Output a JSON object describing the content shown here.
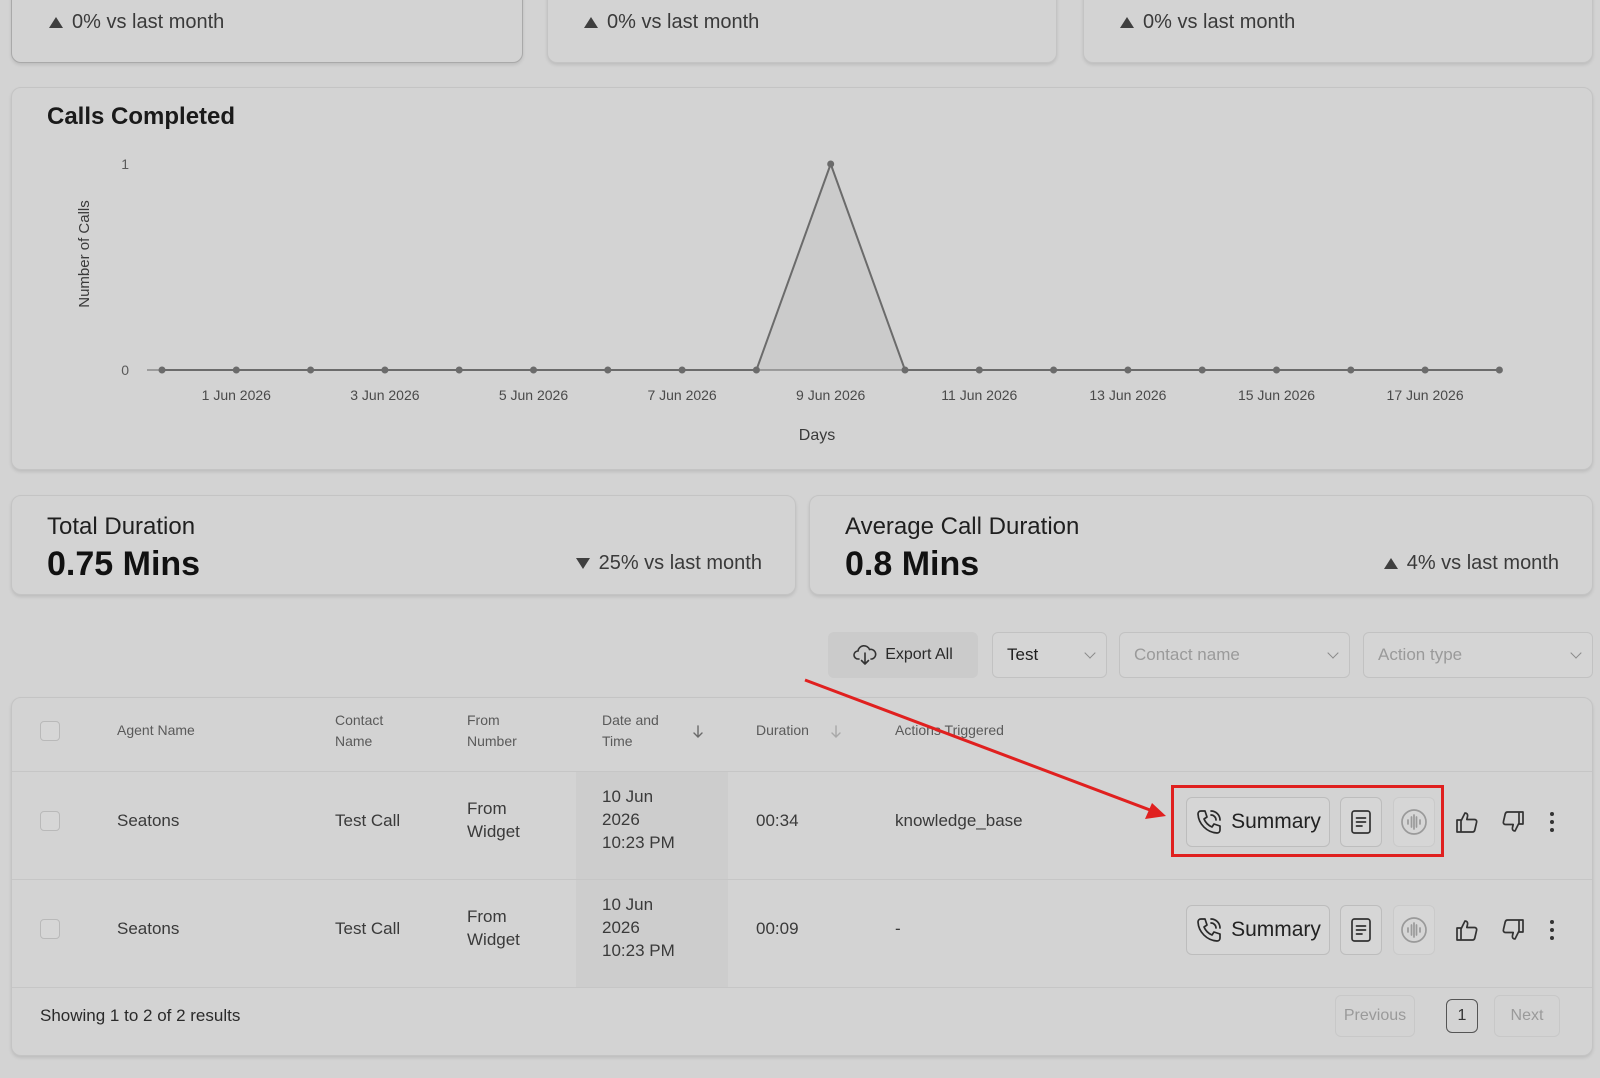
{
  "top_cards": [
    {
      "delta": "0% vs last month",
      "direction": "up"
    },
    {
      "delta": "0% vs last month",
      "direction": "up"
    },
    {
      "delta": "0% vs last month",
      "direction": "up"
    }
  ],
  "chart": {
    "title": "Calls Completed"
  },
  "chart_data": {
    "type": "line",
    "title": "Calls Completed",
    "xlabel": "Days",
    "ylabel": "Number of Calls",
    "ylim": [
      0,
      1
    ],
    "y_ticks": [
      "0",
      "1"
    ],
    "x_tick_labels": [
      "1 Jun 2026",
      "3 Jun 2026",
      "5 Jun 2026",
      "7 Jun 2026",
      "9 Jun 2026",
      "11 Jun 2026",
      "13 Jun 2026",
      "15 Jun 2026",
      "17 Jun 2026"
    ],
    "x": [
      "31 May 2026",
      "1 Jun 2026",
      "2 Jun 2026",
      "3 Jun 2026",
      "4 Jun 2026",
      "5 Jun 2026",
      "6 Jun 2026",
      "7 Jun 2026",
      "8 Jun 2026",
      "9 Jun 2026",
      "10 Jun 2026",
      "11 Jun 2026",
      "12 Jun 2026",
      "13 Jun 2026",
      "14 Jun 2026",
      "15 Jun 2026",
      "16 Jun 2026",
      "17 Jun 2026",
      "18 Jun 2026"
    ],
    "series": [
      {
        "values": [
          0,
          0,
          0,
          0,
          0,
          0,
          0,
          0,
          0,
          1,
          0,
          0,
          0,
          0,
          0,
          0,
          0,
          0,
          0
        ]
      }
    ],
    "grid": false,
    "line_color": "#6b6b6b"
  },
  "stats": {
    "total_duration": {
      "title": "Total Duration",
      "value": "0.75 Mins",
      "delta": "25% vs last month",
      "direction": "down"
    },
    "avg_duration": {
      "title": "Average Call Duration",
      "value": "0.8 Mins",
      "delta": "4% vs last month",
      "direction": "up"
    }
  },
  "toolbar": {
    "export_label": "Export All",
    "agent_select": "Test",
    "contact_placeholder": "Contact name",
    "action_placeholder": "Action type"
  },
  "table": {
    "headers": {
      "agent": "Agent Name",
      "contact_1": "Contact",
      "contact_2": "Name",
      "from_1": "From",
      "from_2": "Number",
      "date_1": "Date and",
      "date_2": "Time",
      "duration": "Duration",
      "actions": "Actions Triggered"
    },
    "rows": [
      {
        "agent": "Seatons",
        "contact": "Test Call",
        "from_1": "From",
        "from_2": "Widget",
        "date_1": "10 Jun",
        "date_2": "2026",
        "date_3": "10:23 PM",
        "duration": "00:34",
        "actions": "knowledge_base",
        "summary_label": "Summary"
      },
      {
        "agent": "Seatons",
        "contact": "Test Call",
        "from_1": "From",
        "from_2": "Widget",
        "date_1": "10 Jun",
        "date_2": "2026",
        "date_3": "10:23 PM",
        "duration": "00:09",
        "actions": "-",
        "summary_label": "Summary"
      }
    ],
    "footer": {
      "results": "Showing 1 to 2 of 2 results",
      "previous": "Previous",
      "page": "1",
      "next": "Next"
    }
  },
  "annotation_color": "#e0201f"
}
